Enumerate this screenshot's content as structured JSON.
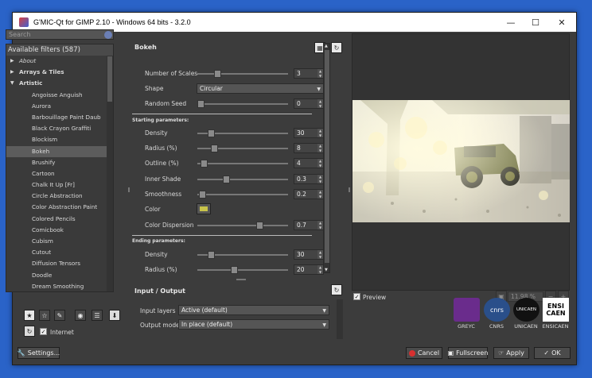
{
  "window": {
    "title": "G'MIC-Qt for GIMP 2.10 - Windows 64 bits - 3.2.0"
  },
  "search": {
    "placeholder": "Search"
  },
  "filters": {
    "header": "Available filters (587)",
    "items": [
      {
        "label": "About",
        "kind": "cat-italic"
      },
      {
        "label": "Arrays & Tiles",
        "kind": "cat"
      },
      {
        "label": "Artistic",
        "kind": "cat-open"
      },
      {
        "label": "Angoisse Anguish",
        "kind": "sub"
      },
      {
        "label": "Aurora",
        "kind": "sub"
      },
      {
        "label": "Barbouillage Paint Daub",
        "kind": "sub"
      },
      {
        "label": "Black Crayon Graffiti",
        "kind": "sub"
      },
      {
        "label": "Blockism",
        "kind": "sub"
      },
      {
        "label": "Bokeh",
        "kind": "sub-selected"
      },
      {
        "label": "Brushify",
        "kind": "sub"
      },
      {
        "label": "Cartoon",
        "kind": "sub"
      },
      {
        "label": "Chalk It Up [Fr]",
        "kind": "sub"
      },
      {
        "label": "Circle Abstraction",
        "kind": "sub"
      },
      {
        "label": "Color Abstraction Paint",
        "kind": "sub"
      },
      {
        "label": "Colored Pencils",
        "kind": "sub"
      },
      {
        "label": "Comicbook",
        "kind": "sub"
      },
      {
        "label": "Cubism",
        "kind": "sub"
      },
      {
        "label": "Cutout",
        "kind": "sub"
      },
      {
        "label": "Diffusion Tensors",
        "kind": "sub"
      },
      {
        "label": "Doodle",
        "kind": "sub"
      },
      {
        "label": "Dream Smoothing",
        "kind": "sub"
      }
    ]
  },
  "internet": {
    "label": "Internet",
    "checked": true
  },
  "settings_label": "Settings...",
  "params": {
    "title": "Bokeh",
    "rows": [
      {
        "label": "Number of Scales",
        "value": "3",
        "fraction": 0.2
      },
      {
        "label": "Shape",
        "value": "Circular",
        "type": "combo"
      },
      {
        "label": "Random Seed",
        "value": "0",
        "fraction": 0.0
      },
      {
        "label": "Density",
        "value": "30",
        "fraction": 0.12
      },
      {
        "label": "Radius (%)",
        "value": "8",
        "fraction": 0.16
      },
      {
        "label": "Outline (%)",
        "value": "4",
        "fraction": 0.04
      },
      {
        "label": "Inner Shade",
        "value": "0.3",
        "fraction": 0.3
      },
      {
        "label": "Smoothness",
        "value": "0.2",
        "fraction": 0.02
      },
      {
        "label": "Color",
        "type": "color",
        "swatch": "#c8c34a"
      },
      {
        "label": "Color Dispersion",
        "value": "0.7",
        "fraction": 0.7
      },
      {
        "label": "Density",
        "value": "30",
        "fraction": 0.12
      },
      {
        "label": "Radius (%)",
        "value": "20",
        "fraction": 0.4
      }
    ],
    "starting_label": "Starting parameters:",
    "ending_label": "Ending parameters:"
  },
  "io": {
    "title": "Input / Output",
    "input_label": "Input layers",
    "input_value": "Active (default)",
    "output_label": "Output mode",
    "output_value": "In place (default)"
  },
  "preview": {
    "label": "Preview",
    "checked": true,
    "zoom": "11.98 %"
  },
  "logos": [
    {
      "caption": "GREYC",
      "color": "#6a2c8c"
    },
    {
      "caption": "CNRS",
      "color": "#2a4f8a",
      "text": "cnrs"
    },
    {
      "caption": "UNICAEN",
      "color": "#111111",
      "text": "UNICAEN"
    },
    {
      "caption": "ENSICAEN",
      "color": "#ffffff",
      "text": "ENSI CAEN"
    }
  ],
  "buttons": {
    "cancel": "Cancel",
    "fullscreen": "Fullscreen",
    "apply": "Apply",
    "ok": "OK"
  }
}
